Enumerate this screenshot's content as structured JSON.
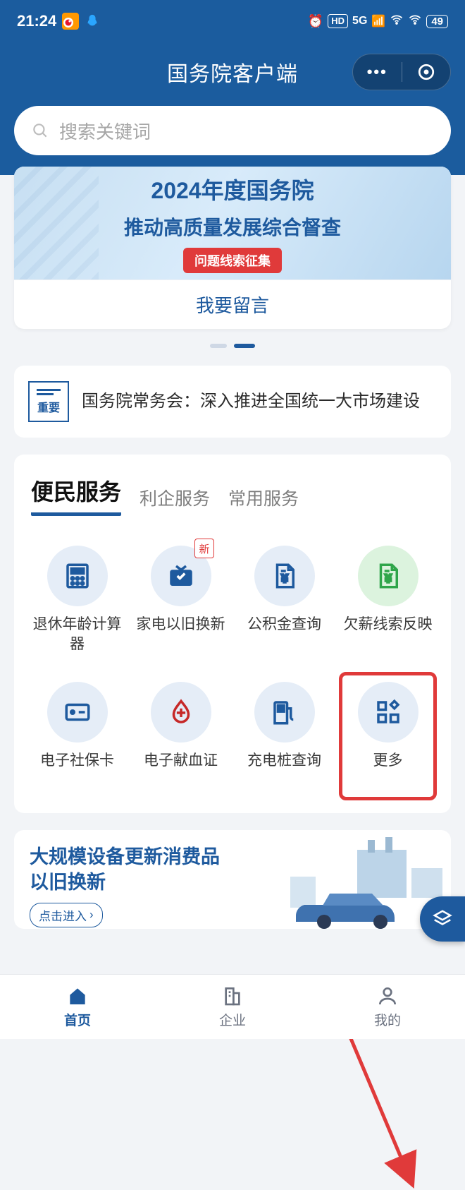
{
  "status": {
    "time": "21:24",
    "hd": "HD",
    "net": "5G",
    "battery": "49"
  },
  "titlebar": {
    "title": "国务院客户端"
  },
  "search": {
    "placeholder": "搜索关键词"
  },
  "banner": {
    "line1": "2024年度国务院",
    "line2": "推动高质量发展综合督查",
    "pill": "问题线索征集",
    "action": "我要留言"
  },
  "news": {
    "badge_label": "重要",
    "text": "国务院常务会：深入推进全国统一大市场建设"
  },
  "service_tabs": {
    "tab1": "便民服务",
    "tab2": "利企服务",
    "tab3": "常用服务"
  },
  "services": {
    "s1": "退休年龄计算器",
    "s2": "家电以旧换新",
    "s2_badge": "新",
    "s3": "公积金查询",
    "s4": "欠薪线索反映",
    "s5": "电子社保卡",
    "s6": "电子献血证",
    "s7": "充电桩查询",
    "s8": "更多"
  },
  "promo": {
    "title_l1": "大规模设备更新消费品",
    "title_l2": "以旧换新",
    "button": "点击进入"
  },
  "nav": {
    "home": "首页",
    "biz": "企业",
    "mine": "我的"
  }
}
